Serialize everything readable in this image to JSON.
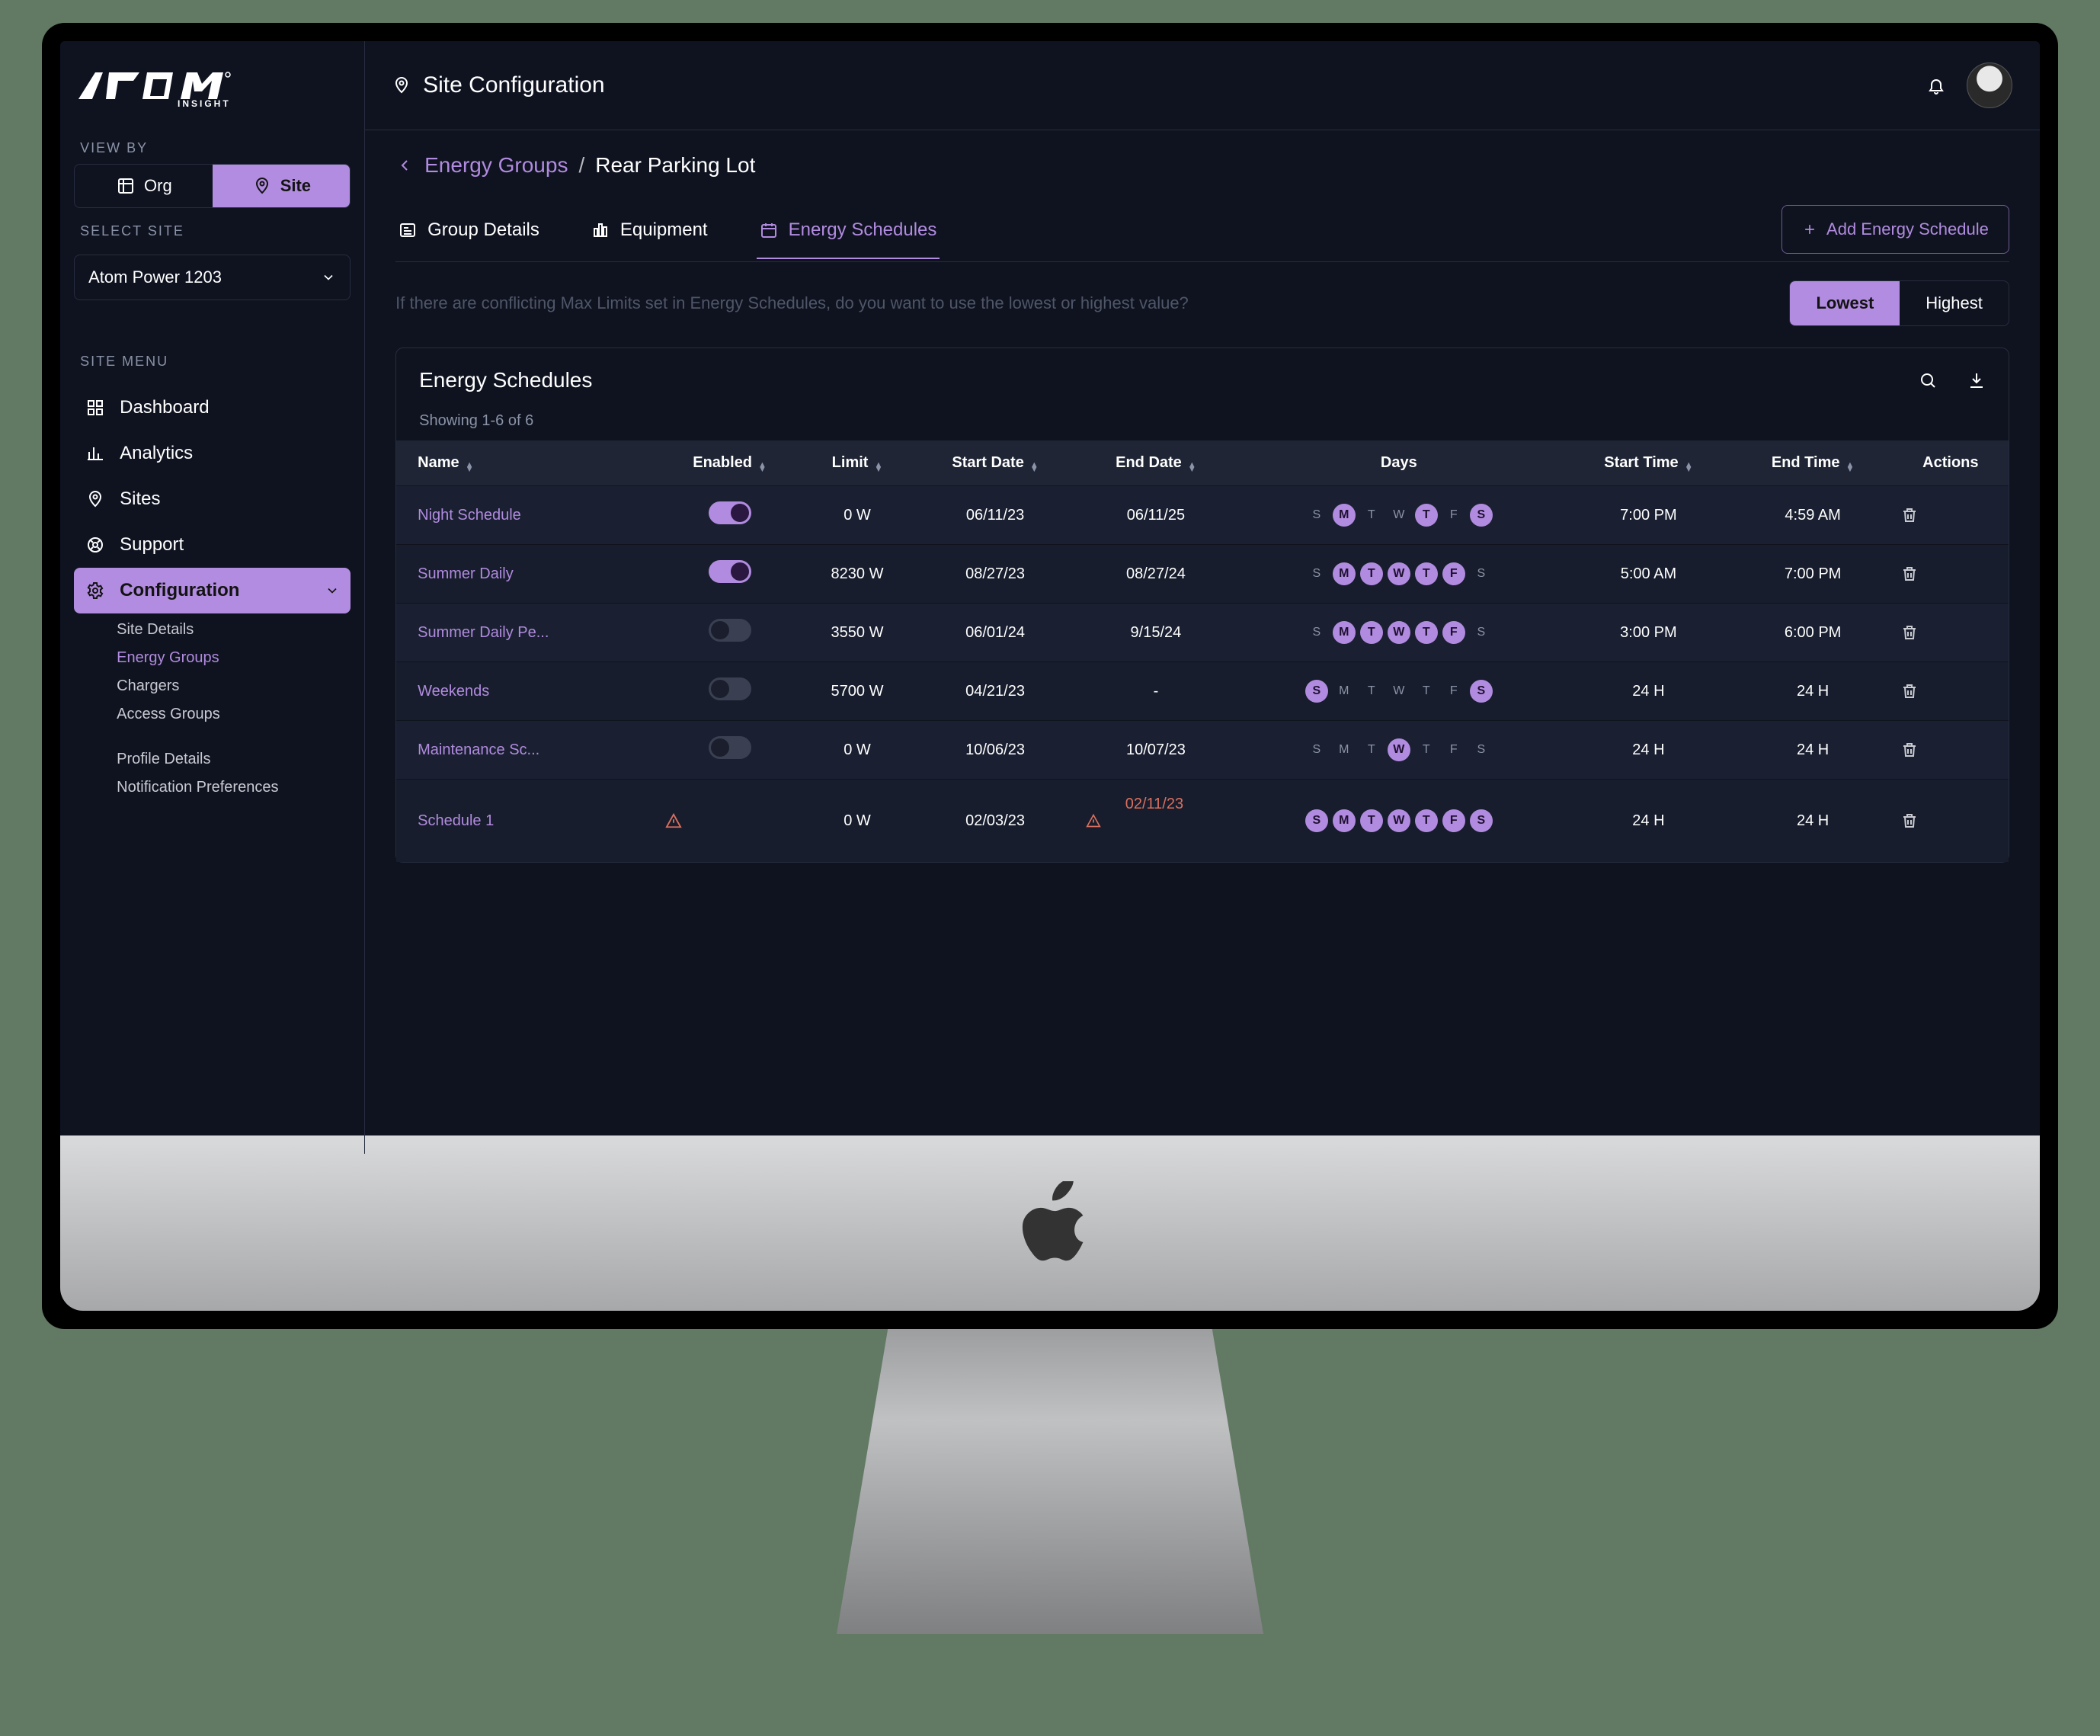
{
  "brand": {
    "name": "ATOM",
    "sub": "INSIGHT"
  },
  "header": {
    "pageTitle": "Site Configuration"
  },
  "sidebar": {
    "viewByLabel": "VIEW BY",
    "orgLabel": "Org",
    "siteLabel": "Site",
    "selectSiteLabel": "SELECT SITE",
    "selectedSite": "Atom Power 1203",
    "siteMenuLabel": "SITE  MENU",
    "items": {
      "dashboard": "Dashboard",
      "analytics": "Analytics",
      "sites": "Sites",
      "support": "Support",
      "configuration": "Configuration"
    },
    "configSub": {
      "siteDetails": "Site Details",
      "energyGroups": "Energy Groups",
      "chargers": "Chargers",
      "accessGroups": "Access Groups",
      "profileDetails": "Profile Details",
      "notificationPrefs": "Notification Preferences"
    }
  },
  "breadcrumb": {
    "parent": "Energy Groups",
    "current": "Rear Parking Lot"
  },
  "tabs": {
    "group": "Group Details",
    "equipment": "Equipment",
    "schedules": "Energy Schedules"
  },
  "addButton": "Add Energy Schedule",
  "conflict": {
    "text": "If there are conflicting Max Limits set in Energy Schedules, do you want to use the lowest or highest value?",
    "lowest": "Lowest",
    "highest": "Highest"
  },
  "card": {
    "title": "Energy Schedules",
    "showing": "Showing 1-6 of 6"
  },
  "columns": {
    "name": "Name",
    "enabled": "Enabled",
    "limit": "Limit",
    "startDate": "Start Date",
    "endDate": "End Date",
    "days": "Days",
    "startTime": "Start Time",
    "endTime": "End Time",
    "actions": "Actions"
  },
  "dayLetters": [
    "S",
    "M",
    "T",
    "W",
    "T",
    "F",
    "S"
  ],
  "rows": [
    {
      "name": "Night Schedule",
      "enabled": true,
      "limit": "0 W",
      "startDate": "06/11/23",
      "endDate": "06/11/25",
      "endDanger": false,
      "days": [
        false,
        true,
        false,
        false,
        true,
        false,
        true
      ],
      "startTime": "7:00 PM",
      "endTime": "4:59 AM"
    },
    {
      "name": "Summer Daily",
      "enabled": true,
      "limit": "8230 W",
      "startDate": "08/27/23",
      "endDate": "08/27/24",
      "endDanger": false,
      "days": [
        false,
        true,
        true,
        true,
        true,
        true,
        false
      ],
      "startTime": "5:00 AM",
      "endTime": "7:00 PM"
    },
    {
      "name": "Summer Daily Pe...",
      "enabled": false,
      "limit": "3550 W",
      "startDate": "06/01/24",
      "endDate": "9/15/24",
      "endDanger": false,
      "days": [
        false,
        true,
        true,
        true,
        true,
        true,
        false
      ],
      "startTime": "3:00 PM",
      "endTime": "6:00 PM"
    },
    {
      "name": "Weekends",
      "enabled": false,
      "limit": "5700 W",
      "startDate": "04/21/23",
      "endDate": "-",
      "endDanger": false,
      "days": [
        true,
        false,
        false,
        false,
        false,
        false,
        true
      ],
      "startTime": "24 H",
      "endTime": "24 H"
    },
    {
      "name": "Maintenance Sc...",
      "enabled": false,
      "limit": "0 W",
      "startDate": "10/06/23",
      "endDate": "10/07/23",
      "endDanger": false,
      "days": [
        false,
        false,
        false,
        true,
        false,
        false,
        false
      ],
      "startTime": "24 H",
      "endTime": "24 H"
    },
    {
      "name": "Schedule 1",
      "enabled": false,
      "enabledWarn": true,
      "limit": "0 W",
      "startDate": "02/03/23",
      "endDate": "02/11/23",
      "endDanger": true,
      "endWarn": true,
      "days": [
        true,
        true,
        true,
        true,
        true,
        true,
        true
      ],
      "startTime": "24 H",
      "endTime": "24 H"
    }
  ]
}
